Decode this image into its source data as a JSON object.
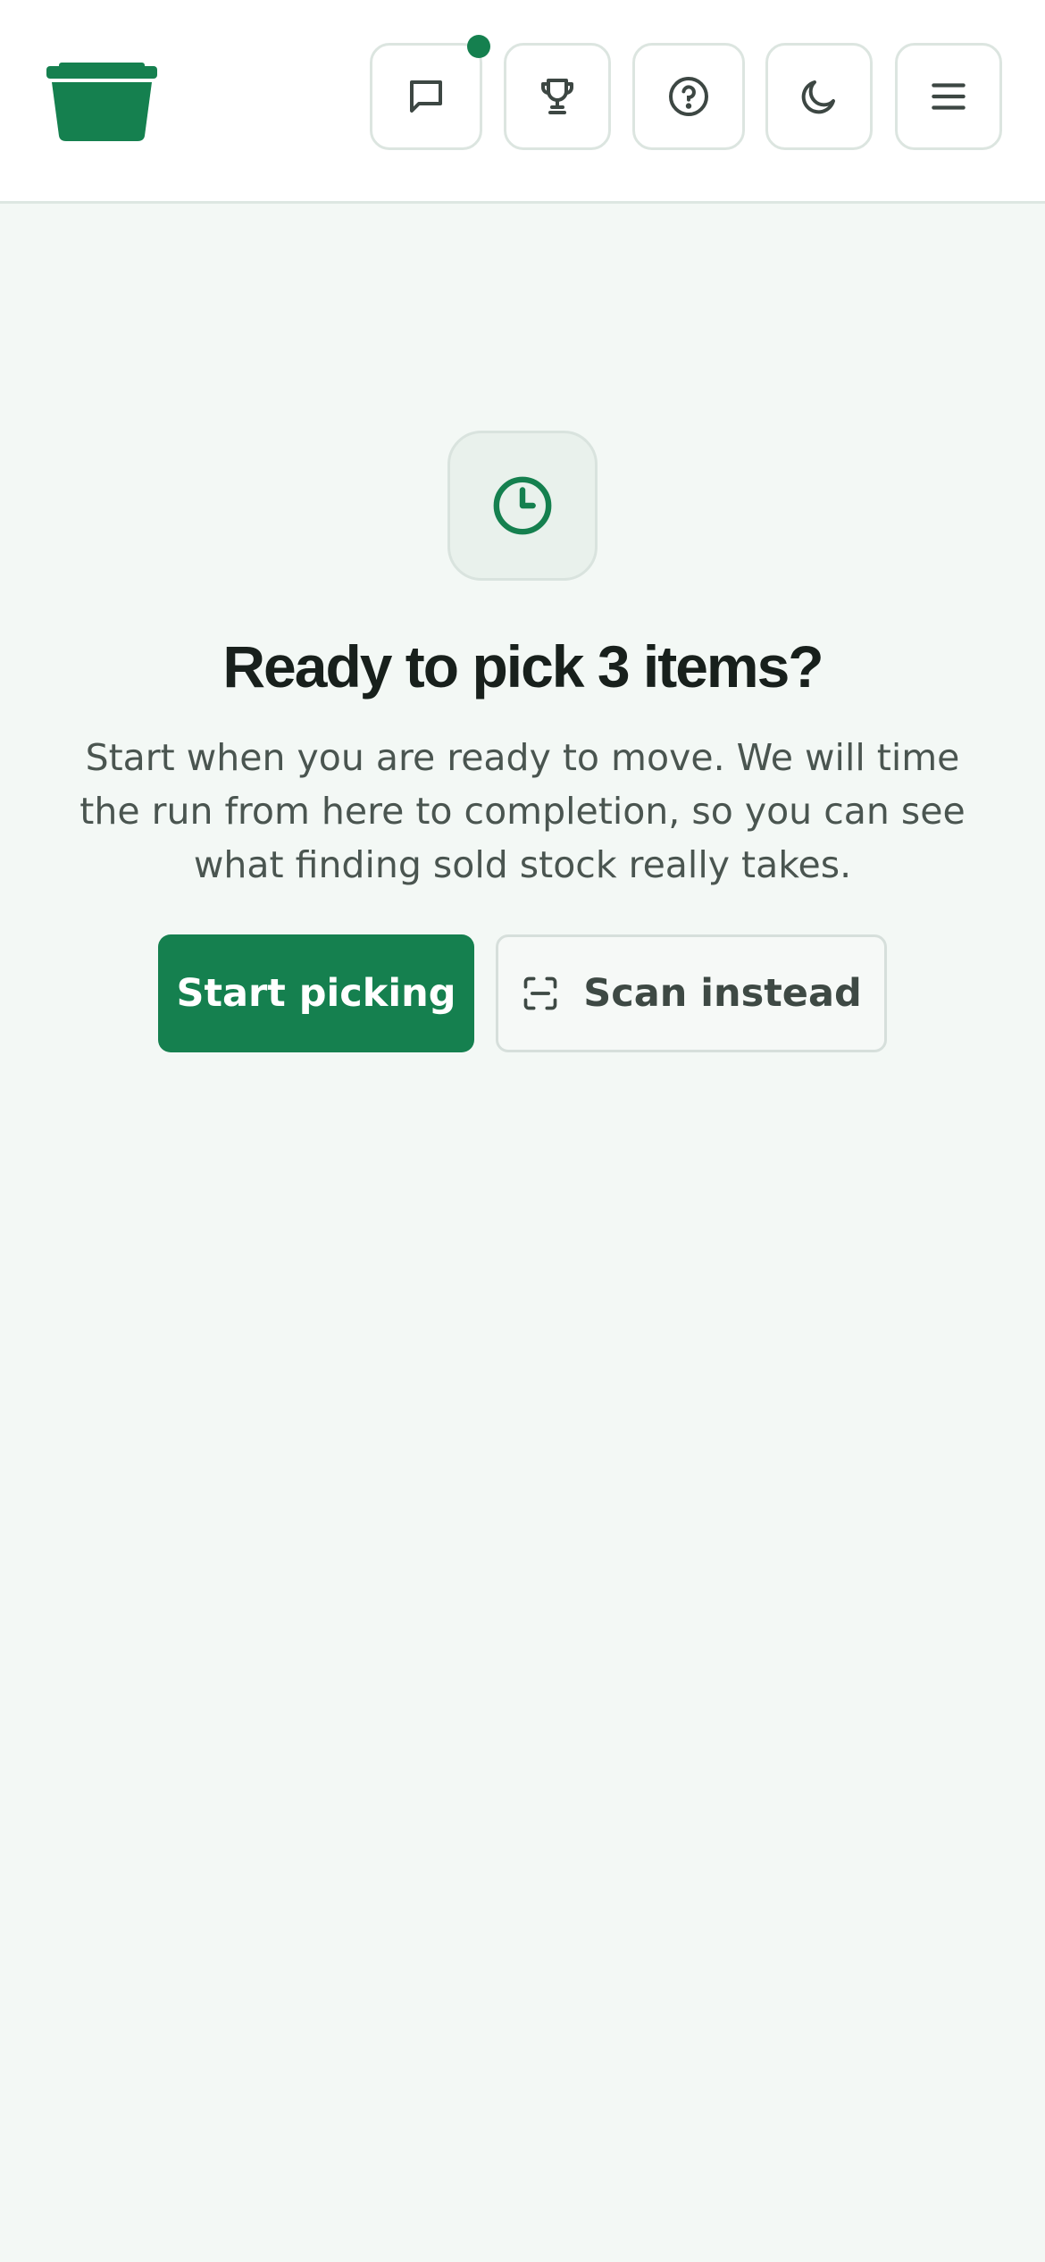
{
  "header": {
    "logo_icon": "bin-icon",
    "buttons": [
      {
        "name": "messages",
        "icon": "chat-bubble-icon",
        "has_notification": true
      },
      {
        "name": "leaderboard",
        "icon": "trophy-icon"
      },
      {
        "name": "help",
        "icon": "help-circle-icon"
      },
      {
        "name": "theme",
        "icon": "moon-icon"
      },
      {
        "name": "menu",
        "icon": "hamburger-icon"
      }
    ]
  },
  "main": {
    "hero_icon": "clock-icon",
    "title": "Ready to pick 3 items?",
    "description": "Start when you are ready to move. We will time the run from here to completion, so you can see what finding sold stock really takes.",
    "primary_button": "Start picking",
    "secondary_button": "Scan instead",
    "secondary_icon": "scan-icon"
  },
  "colors": {
    "accent": "#15804f",
    "background": "#f3f8f5",
    "header_bg": "#ffffff",
    "text": "#18201c",
    "muted_text": "#4a5550"
  }
}
